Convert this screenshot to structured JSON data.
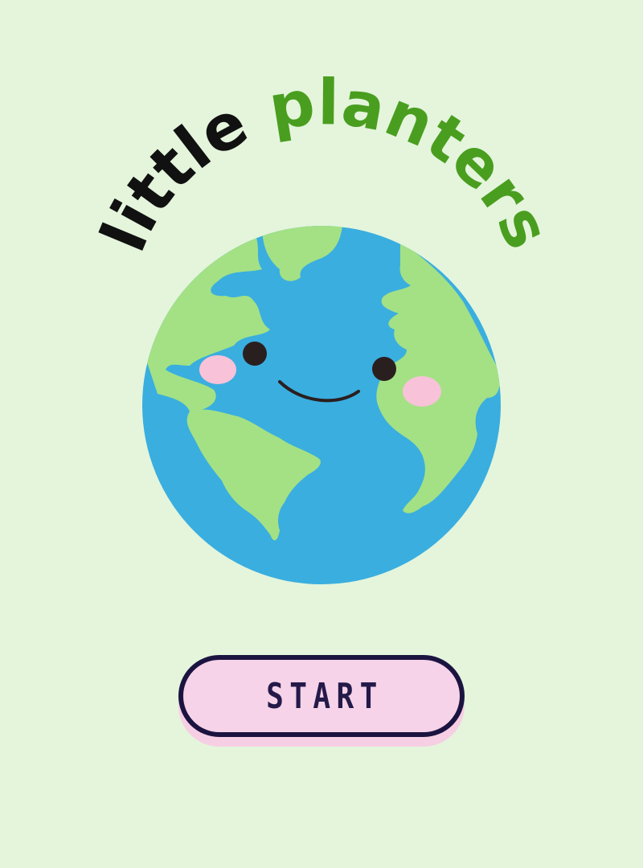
{
  "app": {
    "title_part1": "little",
    "title_part2": "planters"
  },
  "colors": {
    "background": "#e4f5dc",
    "title_part1": "#111111",
    "title_part2": "#4a9e1f",
    "ocean": "#3aaedf",
    "land": "#a3e184",
    "cheeks": "#f8c2d8",
    "face": "#2a1f1f",
    "button_fill": "#f6d3e8",
    "button_border": "#1b1440",
    "button_text": "#241a4a"
  },
  "mascot": {
    "icon": "smiling-earth-icon"
  },
  "start_button": {
    "label": "START"
  }
}
